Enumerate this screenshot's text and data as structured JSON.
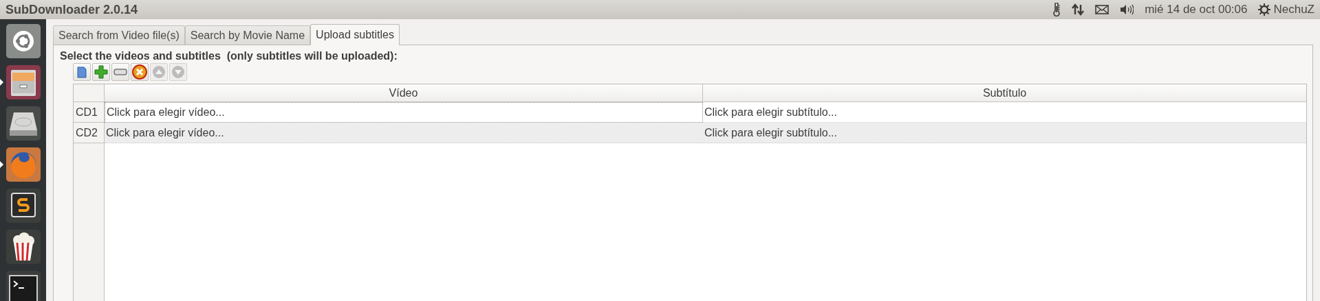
{
  "window": {
    "title": "SubDownloader 2.0.14"
  },
  "panel": {
    "indicators": [
      {
        "kind": "thermometer"
      },
      {
        "kind": "network"
      },
      {
        "kind": "mail"
      },
      {
        "kind": "sound"
      }
    ],
    "clock": "mié 14 de oct 00:06",
    "user": "NechuZ"
  },
  "launcher": [
    {
      "kind": "ubuntu",
      "running": false
    },
    {
      "kind": "files",
      "running": true
    },
    {
      "kind": "disk",
      "running": false
    },
    {
      "kind": "firefox",
      "running": true
    },
    {
      "kind": "sublime",
      "running": false
    },
    {
      "kind": "popcorn",
      "running": false
    },
    {
      "kind": "terminal",
      "running": false
    }
  ],
  "tabs": [
    {
      "label": "Search from Video file(s)",
      "selected": false
    },
    {
      "label": "Search by Movie Name",
      "selected": false
    },
    {
      "label": "Upload subtitles",
      "selected": true
    }
  ],
  "instruction": "Select the videos and subtitles  (only subtitles will be uploaded):",
  "toolbar": [
    {
      "kind": "document",
      "disabled": false
    },
    {
      "kind": "add",
      "disabled": false
    },
    {
      "kind": "remove",
      "disabled": false
    },
    {
      "kind": "clear",
      "disabled": false
    },
    {
      "kind": "up",
      "disabled": true
    },
    {
      "kind": "down",
      "disabled": true
    }
  ],
  "table": {
    "columns": [
      "Vídeo",
      "Subtítulo"
    ],
    "rows": [
      {
        "header": "CD1",
        "video": "Click para elegir vídeo...",
        "subtitle": "Click para elegir subtítulo...",
        "selected": false
      },
      {
        "header": "CD2",
        "video": "Click para elegir vídeo...",
        "subtitle": "Click para elegir subtítulo...",
        "selected": true
      }
    ]
  }
}
